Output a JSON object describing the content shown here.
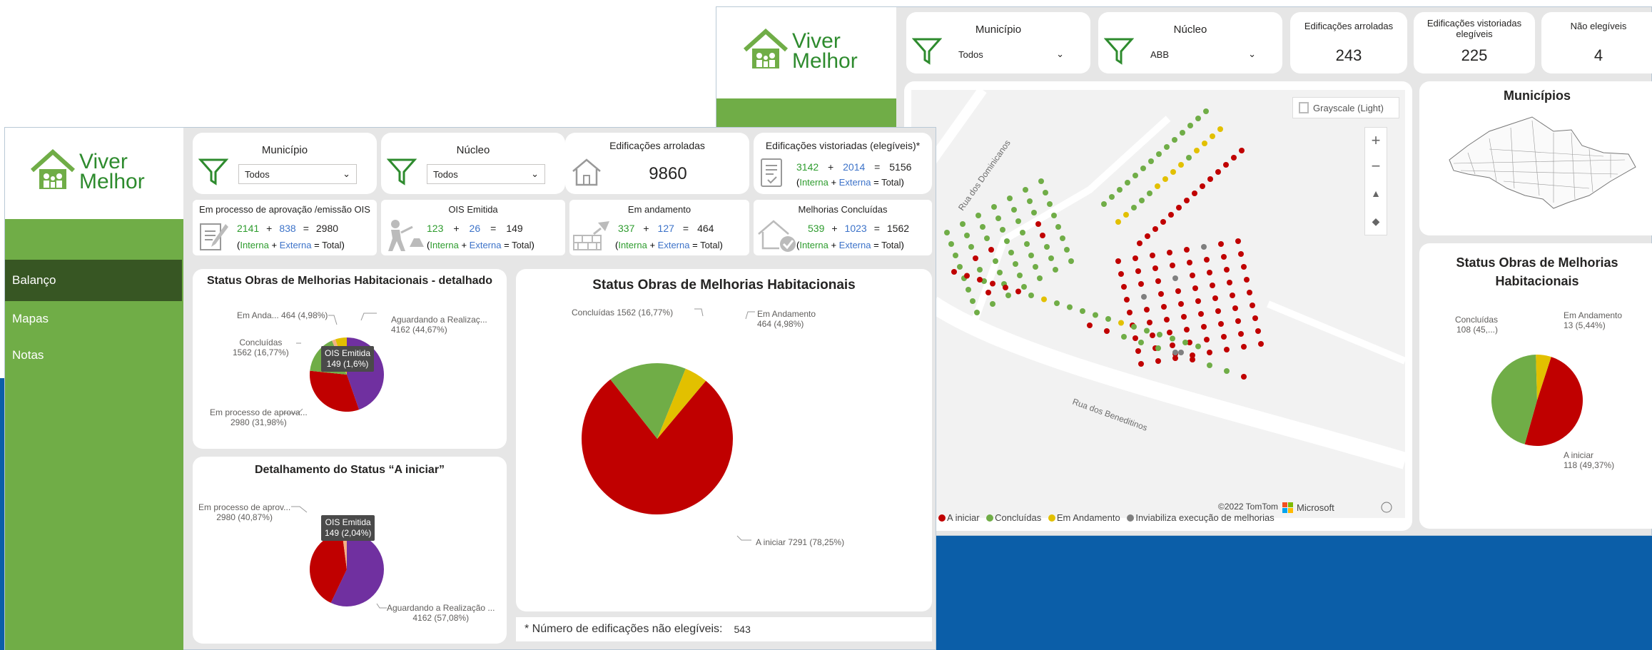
{
  "brand": {
    "line1": "Viver",
    "line2": "Melhor",
    "color": "#2e8b2e"
  },
  "colors": {
    "sidebar": "#70ad47",
    "sidebar_active": "#375623",
    "a_iniciar": "#c00000",
    "concluidas": "#70ad47",
    "em_andamento": "#e2c000",
    "aguardando": "#7030a0",
    "ois": "#f4b183",
    "inviabiliza": "#7f7f7f",
    "blue_band": "#0b5ea8"
  },
  "nav": [
    {
      "label": "Balanço"
    },
    {
      "label": "Mapas"
    },
    {
      "label": "Notas"
    }
  ],
  "back": {
    "filters": {
      "municipio": {
        "title": "Município",
        "value": "Todos"
      },
      "nucleo": {
        "title": "Núcleo",
        "value": "ABB"
      }
    },
    "kpis": [
      {
        "title": "Edificações arroladas",
        "value": "243"
      },
      {
        "title": "Edificações vistoriadas elegíveis",
        "value": "225"
      },
      {
        "title": "Não elegíveis",
        "value": "4"
      }
    ],
    "map": {
      "style_button": "Grayscale (Light)",
      "streets": [
        "Rua dos Dominicanos",
        "Rua dos Beneditinos"
      ],
      "copyright": "©2022 TomTom",
      "microsoft": "Microsoft",
      "legend": [
        {
          "label": "A iniciar",
          "color": "#c00000"
        },
        {
          "label": "Concluídas",
          "color": "#70ad47"
        },
        {
          "label": "Em Andamento",
          "color": "#e2c000"
        },
        {
          "label": "Inviabiliza execução de melhorias",
          "color": "#7f7f7f"
        }
      ]
    },
    "municipios_title": "Municípios",
    "status_title": "Status Obras de Melhorias Habitacionais",
    "status_pie": {
      "slices": [
        {
          "name": "A iniciar",
          "value": 118,
          "label": "A iniciar",
          "detail": "118 (49,37%)"
        },
        {
          "name": "Concluídas",
          "value": 108,
          "label": "Concluídas",
          "detail": "108 (45,...)"
        },
        {
          "name": "Em Andamento",
          "value": 13,
          "label": "Em Andamento",
          "detail": "13 (5,44%)"
        }
      ]
    }
  },
  "front": {
    "filters": {
      "municipio": {
        "title": "Município",
        "value": "Todos"
      },
      "nucleo": {
        "title": "Núcleo",
        "value": "Todos"
      }
    },
    "kpi_arroladas": {
      "title": "Edificações arroladas",
      "value": "9860"
    },
    "kpi_vistoriadas": {
      "title": "Edificações vistoriadas (elegíveis)*",
      "interna": "3142",
      "externa": "2014",
      "total": "5156"
    },
    "kpi_row2": [
      {
        "title": "Em processo de aprovação /emissão OIS",
        "interna": "2141",
        "externa": "838",
        "total": "2980"
      },
      {
        "title": "OIS Emitida",
        "interna": "123",
        "externa": "26",
        "total": "149"
      },
      {
        "title": "Em andamento",
        "interna": "337",
        "externa": "127",
        "total": "464"
      },
      {
        "title": "Melhorias Concluídas",
        "interna": "539",
        "externa": "1023",
        "total": "1562"
      }
    ],
    "formula": {
      "plus": "+",
      "eq": "=",
      "interna": "Interna",
      "externa": "Externa",
      "total": "Total"
    },
    "detalhado": {
      "title": "Status Obras de Melhorias Habitacionais - detalhado",
      "labels": {
        "em_andamento": "Em Anda... 464 (4,98%)",
        "concluidas_1": "Concluídas",
        "concluidas_2": "1562 (16,77%)",
        "aguardando_1": "Aguardando a Realizaç...",
        "aguardando_2": "4162 (44,67%)",
        "processo_1": "Em processo de aprova...",
        "processo_2": "2980 (31,98%)",
        "tooltip_1": "OIS Emitida",
        "tooltip_2": "149 (1,6%)"
      }
    },
    "a_iniciar": {
      "title": "Detalhamento do Status “A iniciar”",
      "labels": {
        "processo_1": "Em processo de aprov...",
        "processo_2": "2980 (40,87%)",
        "aguardando_1": "Aguardando a Realização ...",
        "aguardando_2": "4162 (57,08%)",
        "tooltip_1": "OIS Emitida",
        "tooltip_2": "149 (2,04%)"
      }
    },
    "status": {
      "title": "Status Obras de Melhorias Habitacionais",
      "labels": {
        "concluidas": "Concluídas 1562 (16,77%)",
        "andamento_1": "Em Andamento",
        "andamento_2": "464 (4,98%)",
        "a_iniciar": "A iniciar 7291 (78,25%)"
      }
    },
    "nao_elegiveis": {
      "label": "* Número de edificações não elegíveis:",
      "value": "543"
    }
  },
  "chart_data": [
    {
      "type": "pie",
      "title": "Status Obras de Melhorias Habitacionais - detalhado",
      "categories": [
        "Aguardando a Realização",
        "Em processo de aprovação",
        "Concluídas",
        "OIS Emitida",
        "Em Andamento"
      ],
      "values": [
        4162,
        2980,
        1562,
        149,
        464
      ],
      "colors": [
        "#7030a0",
        "#c00000",
        "#70ad47",
        "#f4b183",
        "#e2c000"
      ]
    },
    {
      "type": "pie",
      "title": "Detalhamento do Status “A iniciar”",
      "categories": [
        "Aguardando a Realização",
        "Em processo de aprovação",
        "OIS Emitida"
      ],
      "values": [
        4162,
        2980,
        149
      ],
      "colors": [
        "#7030a0",
        "#c00000",
        "#f4b183"
      ]
    },
    {
      "type": "pie",
      "title": "Status Obras de Melhorias Habitacionais",
      "categories": [
        "A iniciar",
        "Concluídas",
        "Em Andamento"
      ],
      "values": [
        7291,
        1562,
        464
      ],
      "colors": [
        "#c00000",
        "#70ad47",
        "#e2c000"
      ]
    },
    {
      "type": "pie",
      "title": "Status Obras de Melhorias Habitacionais",
      "categories": [
        "A iniciar",
        "Concluídas",
        "Em Andamento"
      ],
      "values": [
        118,
        108,
        13
      ],
      "colors": [
        "#c00000",
        "#70ad47",
        "#e2c000"
      ]
    }
  ]
}
